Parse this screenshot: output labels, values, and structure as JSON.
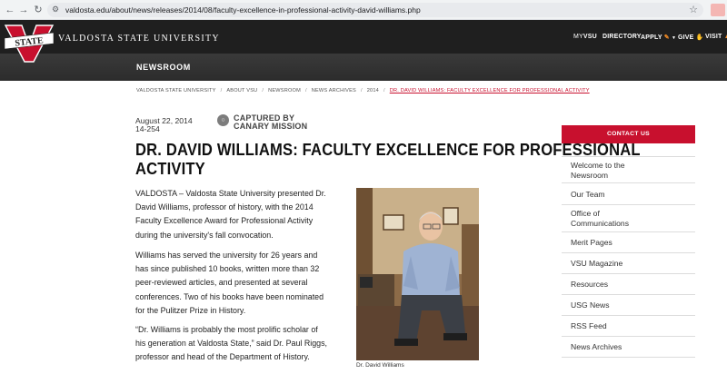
{
  "browser": {
    "url": "valdosta.edu/about/news/releases/2014/08/faculty-excellence-in-professional-activity-david-williams.php"
  },
  "header": {
    "logo_text": "STATE",
    "logo_letter": "V",
    "university_name": "VALDOSTA STATE UNIVERSITY",
    "nav": {
      "myvsu_prefix": "MY",
      "myvsu_suffix": "VSU",
      "directory": "DIRECTORY",
      "apply": "APPLY",
      "give": "GIVE",
      "visit": "VISIT"
    },
    "section_title": "NEWSROOM"
  },
  "breadcrumb": {
    "items": [
      "VALDOSTA STATE UNIVERSITY",
      "ABOUT VSU",
      "NEWSROOM",
      "NEWS ARCHIVES",
      "2014"
    ],
    "current": "DR. DAVID WILLIAMS: FACULTY EXCELLENCE FOR PROFESSIONAL ACTIVITY"
  },
  "article": {
    "date": "August 22, 2014",
    "id": "14-254",
    "captured_line1": "CAPTURED BY",
    "captured_line2": "CANARY MISSION",
    "title_line1": "DR. DAVID WILLIAMS: FACULTY EXCELLENCE FOR PROFESSIONAL",
    "title_line2": "ACTIVITY",
    "p1": [
      "VALDOSTA – Valdosta State University presented Dr.",
      "David Williams, professor of history, with the 2014",
      "Faculty Excellence Award for Professional Activity",
      "during the university's fall convocation."
    ],
    "p2": [
      "Williams has served the university for 26 years and",
      "has since published 10 books, written more than 32",
      "peer-reviewed articles, and presented at several",
      "conferences. Two of his books have been nominated",
      "for the Pulitzer Prize in History."
    ],
    "p3": [
      "“Dr. Williams is probably the most prolific scholar of",
      "his generation at Valdosta State,” said Dr. Paul Riggs,",
      "professor and head of the Department of History."
    ],
    "photo_caption": "Dr. David Williams"
  },
  "sidebar": {
    "contact_label": "CONTACT US",
    "items": [
      [
        "Welcome to the",
        "Newsroom"
      ],
      [
        "Our Team"
      ],
      [
        "Office of",
        "Communications"
      ],
      [
        "Merit Pages"
      ],
      [
        "VSU Magazine"
      ],
      [
        "Resources"
      ],
      [
        "USG News"
      ],
      [
        "RSS Feed"
      ],
      [
        "News Archives"
      ]
    ]
  },
  "colors": {
    "brand_red": "#c8102e",
    "header_dark": "#1f1f1f",
    "accent_orange": "#f08a24"
  }
}
